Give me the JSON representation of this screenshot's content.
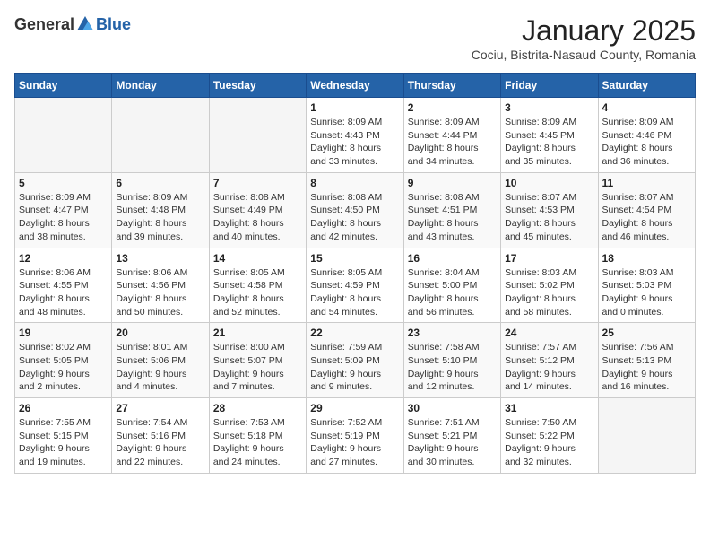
{
  "logo": {
    "general": "General",
    "blue": "Blue"
  },
  "title": "January 2025",
  "subtitle": "Cociu, Bistrita-Nasaud County, Romania",
  "days_header": [
    "Sunday",
    "Monday",
    "Tuesday",
    "Wednesday",
    "Thursday",
    "Friday",
    "Saturday"
  ],
  "weeks": [
    [
      {
        "day": "",
        "info": ""
      },
      {
        "day": "",
        "info": ""
      },
      {
        "day": "",
        "info": ""
      },
      {
        "day": "1",
        "info": "Sunrise: 8:09 AM\nSunset: 4:43 PM\nDaylight: 8 hours\nand 33 minutes."
      },
      {
        "day": "2",
        "info": "Sunrise: 8:09 AM\nSunset: 4:44 PM\nDaylight: 8 hours\nand 34 minutes."
      },
      {
        "day": "3",
        "info": "Sunrise: 8:09 AM\nSunset: 4:45 PM\nDaylight: 8 hours\nand 35 minutes."
      },
      {
        "day": "4",
        "info": "Sunrise: 8:09 AM\nSunset: 4:46 PM\nDaylight: 8 hours\nand 36 minutes."
      }
    ],
    [
      {
        "day": "5",
        "info": "Sunrise: 8:09 AM\nSunset: 4:47 PM\nDaylight: 8 hours\nand 38 minutes."
      },
      {
        "day": "6",
        "info": "Sunrise: 8:09 AM\nSunset: 4:48 PM\nDaylight: 8 hours\nand 39 minutes."
      },
      {
        "day": "7",
        "info": "Sunrise: 8:08 AM\nSunset: 4:49 PM\nDaylight: 8 hours\nand 40 minutes."
      },
      {
        "day": "8",
        "info": "Sunrise: 8:08 AM\nSunset: 4:50 PM\nDaylight: 8 hours\nand 42 minutes."
      },
      {
        "day": "9",
        "info": "Sunrise: 8:08 AM\nSunset: 4:51 PM\nDaylight: 8 hours\nand 43 minutes."
      },
      {
        "day": "10",
        "info": "Sunrise: 8:07 AM\nSunset: 4:53 PM\nDaylight: 8 hours\nand 45 minutes."
      },
      {
        "day": "11",
        "info": "Sunrise: 8:07 AM\nSunset: 4:54 PM\nDaylight: 8 hours\nand 46 minutes."
      }
    ],
    [
      {
        "day": "12",
        "info": "Sunrise: 8:06 AM\nSunset: 4:55 PM\nDaylight: 8 hours\nand 48 minutes."
      },
      {
        "day": "13",
        "info": "Sunrise: 8:06 AM\nSunset: 4:56 PM\nDaylight: 8 hours\nand 50 minutes."
      },
      {
        "day": "14",
        "info": "Sunrise: 8:05 AM\nSunset: 4:58 PM\nDaylight: 8 hours\nand 52 minutes."
      },
      {
        "day": "15",
        "info": "Sunrise: 8:05 AM\nSunset: 4:59 PM\nDaylight: 8 hours\nand 54 minutes."
      },
      {
        "day": "16",
        "info": "Sunrise: 8:04 AM\nSunset: 5:00 PM\nDaylight: 8 hours\nand 56 minutes."
      },
      {
        "day": "17",
        "info": "Sunrise: 8:03 AM\nSunset: 5:02 PM\nDaylight: 8 hours\nand 58 minutes."
      },
      {
        "day": "18",
        "info": "Sunrise: 8:03 AM\nSunset: 5:03 PM\nDaylight: 9 hours\nand 0 minutes."
      }
    ],
    [
      {
        "day": "19",
        "info": "Sunrise: 8:02 AM\nSunset: 5:05 PM\nDaylight: 9 hours\nand 2 minutes."
      },
      {
        "day": "20",
        "info": "Sunrise: 8:01 AM\nSunset: 5:06 PM\nDaylight: 9 hours\nand 4 minutes."
      },
      {
        "day": "21",
        "info": "Sunrise: 8:00 AM\nSunset: 5:07 PM\nDaylight: 9 hours\nand 7 minutes."
      },
      {
        "day": "22",
        "info": "Sunrise: 7:59 AM\nSunset: 5:09 PM\nDaylight: 9 hours\nand 9 minutes."
      },
      {
        "day": "23",
        "info": "Sunrise: 7:58 AM\nSunset: 5:10 PM\nDaylight: 9 hours\nand 12 minutes."
      },
      {
        "day": "24",
        "info": "Sunrise: 7:57 AM\nSunset: 5:12 PM\nDaylight: 9 hours\nand 14 minutes."
      },
      {
        "day": "25",
        "info": "Sunrise: 7:56 AM\nSunset: 5:13 PM\nDaylight: 9 hours\nand 16 minutes."
      }
    ],
    [
      {
        "day": "26",
        "info": "Sunrise: 7:55 AM\nSunset: 5:15 PM\nDaylight: 9 hours\nand 19 minutes."
      },
      {
        "day": "27",
        "info": "Sunrise: 7:54 AM\nSunset: 5:16 PM\nDaylight: 9 hours\nand 22 minutes."
      },
      {
        "day": "28",
        "info": "Sunrise: 7:53 AM\nSunset: 5:18 PM\nDaylight: 9 hours\nand 24 minutes."
      },
      {
        "day": "29",
        "info": "Sunrise: 7:52 AM\nSunset: 5:19 PM\nDaylight: 9 hours\nand 27 minutes."
      },
      {
        "day": "30",
        "info": "Sunrise: 7:51 AM\nSunset: 5:21 PM\nDaylight: 9 hours\nand 30 minutes."
      },
      {
        "day": "31",
        "info": "Sunrise: 7:50 AM\nSunset: 5:22 PM\nDaylight: 9 hours\nand 32 minutes."
      },
      {
        "day": "",
        "info": ""
      }
    ]
  ]
}
